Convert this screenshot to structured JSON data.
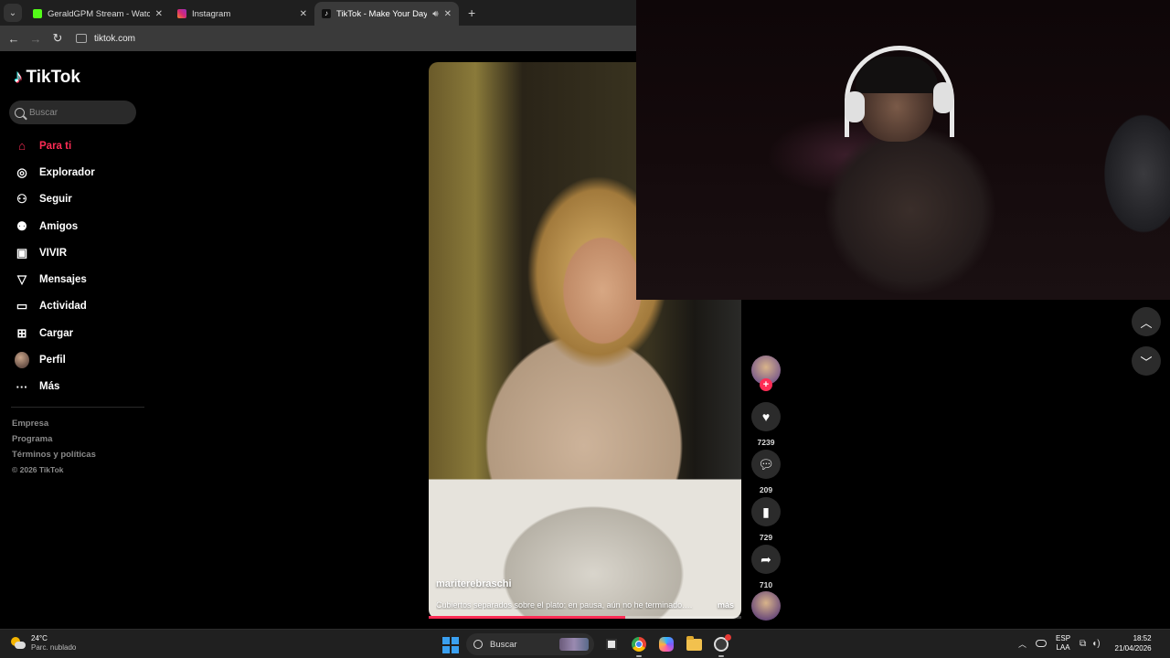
{
  "browser": {
    "tabs": [
      {
        "label": "GeraldGPM Stream - Watch Live",
        "favicon_color": "#53fc18"
      },
      {
        "label": "Instagram",
        "favicon_color": "#d62976"
      },
      {
        "label": "TikTok - Make Your Day",
        "favicon_color": "#000000"
      }
    ],
    "url": "tiktok.com"
  },
  "sidebar": {
    "logo_text": "TikTok",
    "search_placeholder": "Buscar",
    "items": [
      {
        "label": "Para ti",
        "icon": "home-icon"
      },
      {
        "label": "Explorador",
        "icon": "compass-icon"
      },
      {
        "label": "Seguir",
        "icon": "follow-icon"
      },
      {
        "label": "Amigos",
        "icon": "friends-icon"
      },
      {
        "label": "VIVIR",
        "icon": "live-icon"
      },
      {
        "label": "Mensajes",
        "icon": "send-icon"
      },
      {
        "label": "Actividad",
        "icon": "activity-icon"
      },
      {
        "label": "Cargar",
        "icon": "upload-icon"
      },
      {
        "label": "Perfil",
        "icon": "avatar"
      },
      {
        "label": "Más",
        "icon": "more-icon"
      }
    ],
    "footer": [
      "Empresa",
      "Programa",
      "Términos y políticas"
    ],
    "copyright": "© 2026 TikTok"
  },
  "video": {
    "username": "mariterebraschi",
    "description": "Cubiertos separados sobre el plato: en pausa, aún no he terminado.…",
    "more_label": "más",
    "progress": 0.63
  },
  "actions": {
    "likes": "7239",
    "comments": "209",
    "saves": "729",
    "shares": "710"
  },
  "taskbar": {
    "weather_temp": "24°C",
    "weather_desc": "Parc. nublado",
    "search_label": "Buscar",
    "lang_top": "ESP",
    "lang_bottom": "LAA",
    "time": "18:52",
    "date": "21/04/2026"
  },
  "colors": {
    "accent": "#fe2c55",
    "taskbar_bg": "#202020"
  }
}
